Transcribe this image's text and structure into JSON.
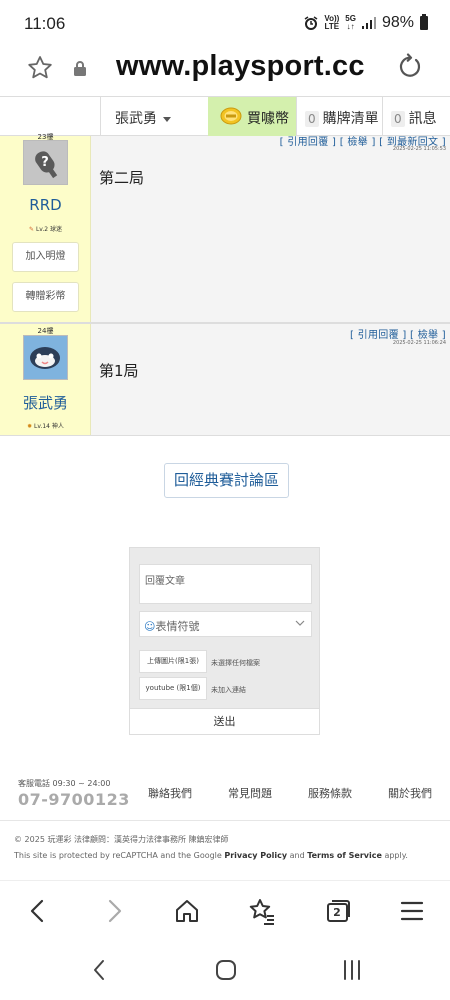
{
  "status_bar": {
    "time": "11:06",
    "network_top": "Vo))",
    "network_bottom": "LTE",
    "gen_label": "5G",
    "battery": "98%"
  },
  "browser": {
    "url": "www.playsport.cc",
    "tab_count": "2"
  },
  "nav": {
    "username": "張武勇",
    "coins_label": "買噱幣",
    "cart_count": "0",
    "cart_label": "購牌清單",
    "msg_count": "0",
    "msg_label": "訊息"
  },
  "posts": [
    {
      "floor": "23樓",
      "username": "RRD",
      "level": "Lv.2 球迷",
      "actions": "[ 引用回覆 ]  [ 檢舉 ]  [ 到最新回文 ]",
      "date": "2025-02-25 11:05:53",
      "text": "第二局",
      "btn_add": "加入明燈",
      "btn_gift": "轉贈彩幣"
    },
    {
      "floor": "24樓",
      "username": "張武勇",
      "level": "Lv.14 神人",
      "actions": "[ 引用回覆 ]  [ 檢舉 ]",
      "date": "2025-02-25 11:06:24",
      "text": "第1局"
    }
  ],
  "back_button": "回經典賽討論區",
  "reply": {
    "placeholder": "回覆文章",
    "emoji_label": "表情符號",
    "upload_image": "上傳圖片(限1張)",
    "upload_image_hint": "未選擇任何檔案",
    "youtube": "youtube (限1個)",
    "youtube_hint": "未加入連結",
    "send": "送出"
  },
  "footer": {
    "hours": "客服電話 09:30 ~ 24:00",
    "phone": "07-9700123",
    "links": [
      "聯絡我們",
      "常見問題",
      "服務條款",
      "關於我們"
    ],
    "copyright": "© 2025 玩運彩 法律顧問：漢英得力法律事務所 陳鎮宏律師",
    "recaptcha_pre": "This site is protected by reCAPTCHA and the Google ",
    "privacy": "Privacy Policy",
    "and": " and ",
    "terms": "Terms of Service",
    "apply": " apply."
  },
  "colors": {
    "link_blue": "#1f5d99",
    "sidebar_yellow": "#fdfdc9",
    "coin_green": "#d4f0ad"
  }
}
